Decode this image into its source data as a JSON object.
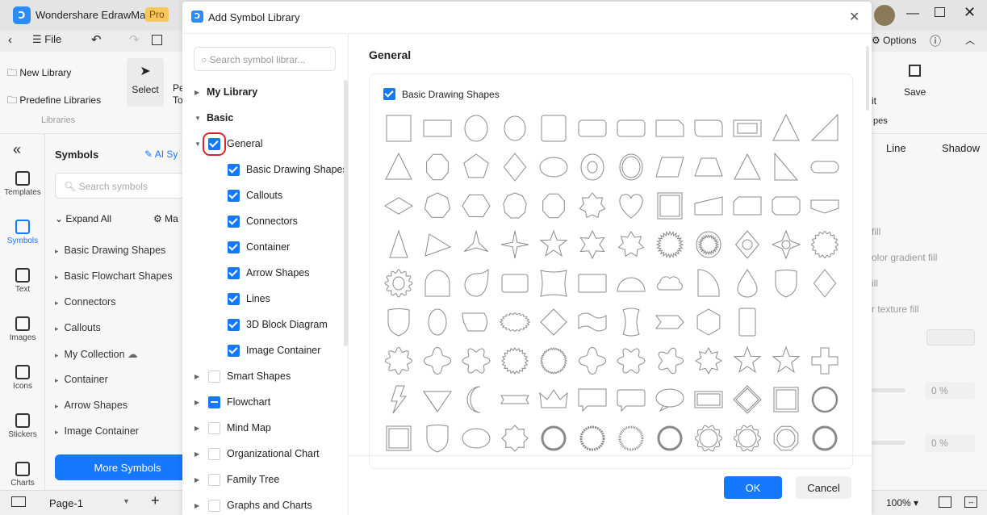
{
  "app": {
    "title": "Wondershare EdrawMax",
    "badge": "Pro",
    "file": "File",
    "options": "Options"
  },
  "ribbon": {
    "new_library": "New Library",
    "predefine": "Predefine Libraries",
    "group": "Libraries",
    "select": "Select",
    "pen_partial_1": "Pe",
    "pen_partial_2": "To",
    "edit_partial": "it",
    "shapes_partial": "pes",
    "save": "Save"
  },
  "rail": [
    {
      "label": "Templates"
    },
    {
      "label": "Symbols"
    },
    {
      "label": "Text"
    },
    {
      "label": "Images"
    },
    {
      "label": "Icons"
    },
    {
      "label": "Stickers"
    },
    {
      "label": "Charts"
    }
  ],
  "symbols_panel": {
    "title": "Symbols",
    "ai": "AI Sy",
    "search_placeholder": "Search symbols",
    "expand_all": "Expand All",
    "manage_partial": "Ma",
    "items": [
      "Basic Drawing Shapes",
      "Basic Flowchart Shapes",
      "Connectors",
      "Callouts",
      "My Collection",
      "Container",
      "Arrow Shapes",
      "Image Container"
    ],
    "more": "More Symbols"
  },
  "right_panel": {
    "tab_line": "Line",
    "tab_shadow": "Shadow",
    "opts": [
      "fill",
      "olor gradient fill",
      "ill",
      "r texture fill"
    ],
    "pct1": "0 %",
    "pct2": "0 %"
  },
  "bottom": {
    "page": "Page-1",
    "zoom": "100%"
  },
  "dialog": {
    "title": "Add Symbol Library",
    "search_placeholder": "Search symbol librar...",
    "section": "General",
    "card_label": "Basic Drawing Shapes",
    "ok": "OK",
    "cancel": "Cancel",
    "tree": [
      {
        "label": "My Library",
        "level": 0,
        "bold": true,
        "arrow": "right"
      },
      {
        "label": "Basic",
        "level": 0,
        "bold": true,
        "arrow": "down"
      },
      {
        "label": "General",
        "level": 1,
        "check": "on",
        "arrow": "down",
        "highlight": true
      },
      {
        "label": "Basic Drawing Shapes",
        "level": 2,
        "check": "on"
      },
      {
        "label": "Callouts",
        "level": 2,
        "check": "on"
      },
      {
        "label": "Connectors",
        "level": 2,
        "check": "on"
      },
      {
        "label": "Container",
        "level": 2,
        "check": "on"
      },
      {
        "label": "Arrow Shapes",
        "level": 2,
        "check": "on"
      },
      {
        "label": "Lines",
        "level": 2,
        "check": "on"
      },
      {
        "label": "3D Block Diagram",
        "level": 2,
        "check": "on"
      },
      {
        "label": "Image Container",
        "level": 2,
        "check": "on"
      },
      {
        "label": "Smart Shapes",
        "level": 1,
        "check": "off",
        "arrow": "right"
      },
      {
        "label": "Flowchart",
        "level": 1,
        "check": "mixed",
        "arrow": "right"
      },
      {
        "label": "Mind Map",
        "level": 1,
        "check": "off",
        "arrow": "right"
      },
      {
        "label": "Organizational Chart",
        "level": 1,
        "check": "off",
        "arrow": "right"
      },
      {
        "label": "Family Tree",
        "level": 1,
        "check": "off",
        "arrow": "right"
      },
      {
        "label": "Graphs and Charts",
        "level": 1,
        "check": "off",
        "arrow": "right"
      }
    ],
    "shapes": [
      [
        "square",
        "rectangle",
        "circle",
        "ellipse-v",
        "rounded-square",
        "rounded-rectangle",
        "rounded-rectangle",
        "snip-rectangle",
        "round-corner-rectangle",
        "double-rectangle",
        "triangle",
        "right-triangle-slant"
      ],
      [
        "triangle",
        "octagon-tall",
        "pentagon",
        "diamond",
        "ellipse",
        "ring",
        "double-circle",
        "parallelogram",
        "trapezoid",
        "rounded-triangle",
        "right-triangle",
        "pill"
      ],
      [
        "rhombus",
        "heptagon",
        "hexagon",
        "nonagon",
        "octagon",
        "star-7",
        "heart",
        "frame",
        "manual-input",
        "snip-corner",
        "octagon-flat",
        "off-page"
      ],
      [
        "tall-triangle",
        "arrow-triangle",
        "star-3",
        "star-4",
        "star-5",
        "star-6",
        "star-7b",
        "seal-24",
        "seal-ring",
        "diamond-circle",
        "star-4-circle",
        "seal-16"
      ],
      [
        "gear",
        "round-drop",
        "leaf",
        "rounded-rect",
        "concave-square",
        "rect-wide",
        "semicircle",
        "cloud",
        "quarter-circle",
        "drop",
        "shield",
        "diamond"
      ],
      [
        "shield",
        "egg",
        "curved-parallelogram",
        "scalloped-rect",
        "scalloped-diamond",
        "wave-flag",
        "wave-tall",
        "chevron",
        "hexagon-pointy",
        "tall-rect",
        "",
        ""
      ],
      [
        "flower-8",
        "flower-4",
        "flower-6",
        "seal-20",
        "seal-32",
        "flower-4",
        "flower-6",
        "flower-5",
        "star-8",
        "star-5",
        "star-5",
        "cross"
      ],
      [
        "lightning",
        "gem",
        "moon",
        "ribbon",
        "crown",
        "callout-rect",
        "callout-rounded",
        "callout-oval",
        "frame-rect",
        "diamond-frame",
        "frame-square",
        "circle-thick"
      ],
      [
        "frame-square",
        "shield",
        "ellipse",
        "star-badge",
        "ring-thick",
        "ring-beaded",
        "ring-dashed",
        "ring-thick",
        "flower-ring",
        "flower-ring",
        "octagon-ring",
        "ring-thick"
      ]
    ]
  },
  "colors": {
    "accent": "#1677ff",
    "highlight": "#d9262c",
    "shape_stroke": "#8a8a8a"
  }
}
